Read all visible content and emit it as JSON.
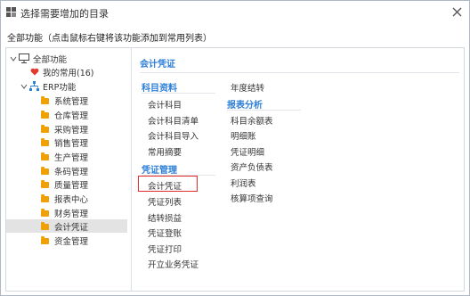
{
  "window": {
    "title": "选择需要增加的目录"
  },
  "instruction": "全部功能（点击鼠标右键将该功能添加到常用列表）",
  "tree": {
    "root_label": "全部功能",
    "favorites_label": "我的常用(16)",
    "erp_label": "ERP功能",
    "items": [
      "系统管理",
      "仓库管理",
      "采购管理",
      "销售管理",
      "生产管理",
      "条码管理",
      "质量管理",
      "报表中心",
      "财务管理",
      "会计凭证",
      "资金管理"
    ],
    "selected": "会计凭证"
  },
  "content": {
    "title": "会计凭证",
    "col1": {
      "section1": {
        "heading": "科目资料",
        "links": [
          "会计科目",
          "会计科目清单",
          "会计科目导入",
          "常用摘要"
        ]
      },
      "section2": {
        "heading": "凭证管理",
        "links": [
          "会计凭证",
          "凭证列表",
          "结转损益",
          "凭证登账",
          "凭证打印",
          "开立业务凭证"
        ]
      }
    },
    "col2": {
      "top_links": [
        "年度结转"
      ],
      "section": {
        "heading": "报表分析",
        "links": [
          "科目余额表",
          "明细账",
          "凭证明细",
          "资产负债表",
          "利润表",
          "核算项查询"
        ]
      }
    },
    "highlighted": "会计凭证"
  },
  "colors": {
    "accent_blue": "#2d7fd8",
    "highlight_red": "#e22b2b",
    "folder_orange": "#f0a000",
    "favorite_red": "#e23a2e"
  }
}
